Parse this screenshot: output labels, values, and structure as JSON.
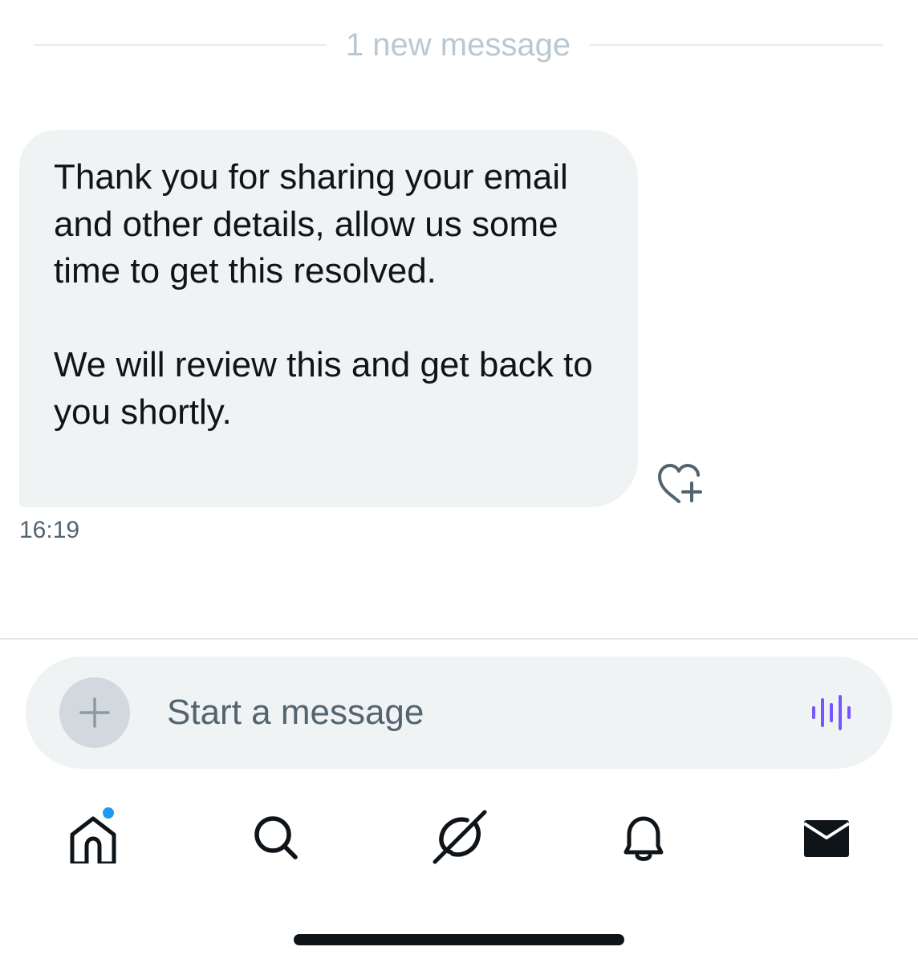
{
  "divider": {
    "label": "1 new message"
  },
  "message": {
    "paragraphs": [
      "Thank you for sharing your email and other details, allow us some time to get this resolved.",
      "We will review this and get back to you shortly."
    ],
    "timestamp": "16:19",
    "reaction_icon": "heart-plus-icon"
  },
  "composer": {
    "placeholder": "Start a message",
    "value": "",
    "add_icon": "plus-icon",
    "voice_icon": "voice-waveform-icon",
    "voice_color": "#7856ff"
  },
  "tabbar": {
    "items": [
      {
        "icon": "home-icon",
        "badge": "dot",
        "badge_color": "#1d9bf0"
      },
      {
        "icon": "search-icon"
      },
      {
        "icon": "grok-icon"
      },
      {
        "icon": "bell-icon"
      },
      {
        "icon": "mail-icon",
        "active": true
      }
    ]
  },
  "colors": {
    "bubble_bg": "#eff3f4",
    "text": "#0f1419",
    "muted": "#536471",
    "divider_text": "#b9c8d3"
  }
}
